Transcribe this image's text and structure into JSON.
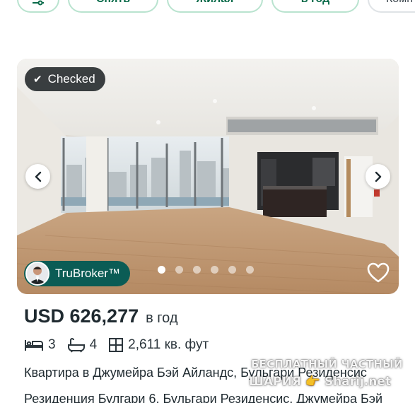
{
  "filters": {
    "chip_icon": "sliders-icon",
    "chip1": "Снять",
    "chip2": "Жилая",
    "chip3": "в год",
    "chip4": "Комн"
  },
  "listing": {
    "badge": "Checked",
    "broker_label": "TruBroker™",
    "carousel": {
      "count": 6,
      "active": 1
    },
    "price": "USD 626,277",
    "period": "в год",
    "bedrooms": "3",
    "bathrooms": "4",
    "area": "2,611 кв. фут",
    "title": "Квартира в Джумейра Бэй Айландс, Бульгари Резиденсис",
    "subtitle": "Резиденция Булгари 6, Бульгари Резиденсис, Джумейра Бэй"
  },
  "watermark": {
    "line1": "БЕСПЛАТНЫЙ ЧАСТНЫЙ",
    "line2": "ШАРИЯ 👉 Sharij.net"
  },
  "colors": {
    "chip_border": "#b9e3cf",
    "chip_text": "#0a6b4a",
    "broker_bg": "#0b5c55",
    "text": "#1f2a30"
  }
}
